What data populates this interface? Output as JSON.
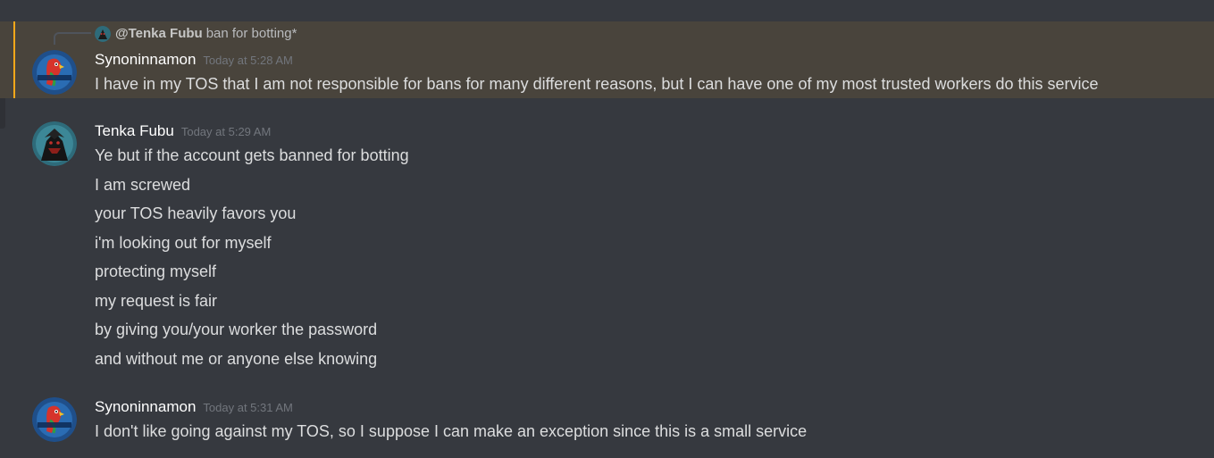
{
  "channel": {
    "messages": [
      {
        "reply": {
          "mention": "@Tenka Fubu",
          "text": "ban for botting*"
        },
        "author": "Synoninnamon",
        "timestamp": "Today at 5:28 AM",
        "avatar_icon": "parrot-avatar",
        "highlighted": true,
        "lines": [
          "I have in my TOS that I am not responsible for bans for many different reasons, but I can have one of my most trusted workers do this service"
        ]
      },
      {
        "author": "Tenka Fubu",
        "timestamp": "Today at 5:29 AM",
        "avatar_icon": "samurai-avatar",
        "lines": [
          "Ye but if the account gets banned for botting",
          "I am screwed",
          "your TOS heavily favors you",
          "i'm looking out for myself",
          "protecting myself",
          "my request is fair",
          "by giving you/your worker the password",
          "and without me or anyone else knowing"
        ]
      },
      {
        "author": "Synoninnamon",
        "timestamp": "Today at 5:31 AM",
        "avatar_icon": "parrot-avatar",
        "lines": [
          "I don't like going against my TOS, so I suppose I can make an exception since this is a small service"
        ]
      }
    ]
  },
  "colors": {
    "background": "#36393f",
    "mention_highlight": "#49443c",
    "mention_bar": "#faa81a",
    "username": "#ffffff",
    "timestamp": "#72767d",
    "text": "#dcddde"
  }
}
